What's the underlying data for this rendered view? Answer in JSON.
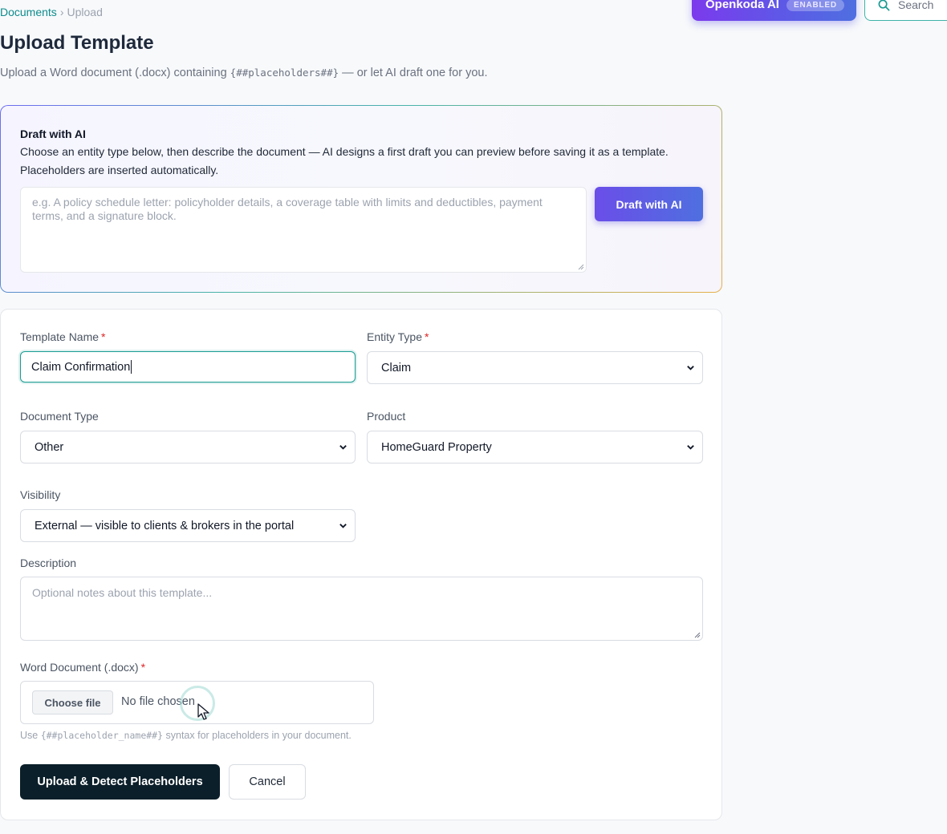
{
  "breadcrumb": {
    "root": "Documents",
    "separator": "›",
    "current": "Upload"
  },
  "header": {
    "ai_label": "Openkoda AI",
    "ai_badge": "ENABLED",
    "search_placeholder": "Search"
  },
  "page": {
    "title": "Upload Template",
    "subtitle_pre": "Upload a Word document (.docx) containing ",
    "subtitle_code": "{##placeholders##}",
    "subtitle_post": " — or let AI draft one for you."
  },
  "ai_draft": {
    "title": "Draft with AI",
    "description": "Choose an entity type below, then describe the document — AI designs a first draft you can preview before saving it as a template. Placeholders are inserted automatically.",
    "placeholder": "e.g. A policy schedule letter: policyholder details, a coverage table with limits and deductibles, payment terms, and a signature block.",
    "button_label": "Draft with AI"
  },
  "form": {
    "template_name": {
      "label": "Template Name",
      "required_mark": "*",
      "value": "Claim Confirmation"
    },
    "entity_type": {
      "label": "Entity Type",
      "required_mark": "*",
      "value": "Claim"
    },
    "document_type": {
      "label": "Document Type",
      "value": "Other"
    },
    "product": {
      "label": "Product",
      "value": "HomeGuard Property"
    },
    "visibility": {
      "label": "Visibility",
      "value": "External — visible to clients & brokers in the portal"
    },
    "description": {
      "label": "Description",
      "placeholder": "Optional notes about this template..."
    },
    "word_document": {
      "label": "Word Document (.docx)",
      "required_mark": "*",
      "choose_label": "Choose file",
      "status": "No file chosen",
      "hint_pre": "Use ",
      "hint_code": "{##placeholder_name##}",
      "hint_post": " syntax for placeholders in your document."
    },
    "submit_label": "Upload & Detect Placeholders",
    "cancel_label": "Cancel"
  },
  "colors": {
    "accent": "#1a9c92",
    "ai_gradient_start": "#7c3aed",
    "ai_gradient_end": "#4f6fe0",
    "primary_button": "#0b1f2a"
  },
  "icons": {
    "search": "search-icon",
    "select_chevron": "chevron-down-icon",
    "cursor": "mouse-pointer-icon"
  }
}
